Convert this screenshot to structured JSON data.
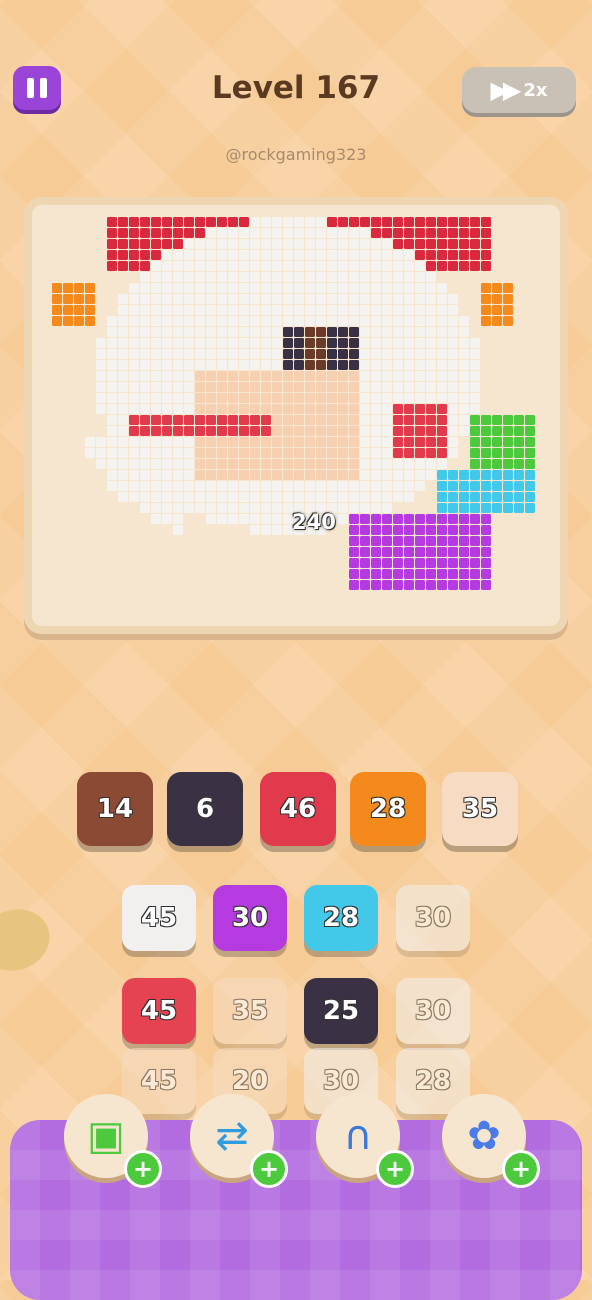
{
  "header": {
    "pause_icon": "pause-icon",
    "level_title": "Level 167",
    "speed_icon": "fast-forward-icon",
    "speed_label": "2x",
    "username": "@rockgaming323"
  },
  "board": {
    "remaining_counter": "240"
  },
  "queue": [
    {
      "value": "14",
      "color": "#8a4a33"
    },
    {
      "value": "6",
      "color": "#3a3244"
    },
    {
      "value": "46",
      "color": "#e13a4c"
    },
    {
      "value": "28",
      "color": "#f58a1c"
    },
    {
      "value": "35",
      "color": "#f7dcc3"
    }
  ],
  "grid": {
    "row1": [
      {
        "value": "45",
        "color": "#f2f0ee"
      },
      {
        "value": "30",
        "color": "#b53be0"
      },
      {
        "value": "28",
        "color": "#42c9ea"
      },
      {
        "value": "30",
        "color": "#f2f0ee"
      }
    ],
    "row2": [
      {
        "value": "45",
        "color": "#e64352"
      },
      {
        "value": "35",
        "color": "#f7dcc3"
      },
      {
        "value": "25",
        "color": "#3a3244"
      },
      {
        "value": "30",
        "color": "#f2f0ee"
      }
    ],
    "row3": [
      {
        "value": "45",
        "color": "#f7dcc3"
      },
      {
        "value": "20",
        "color": "#f7dcc3"
      },
      {
        "value": "30",
        "color": "#f2f0ee"
      },
      {
        "value": "28",
        "color": "#f2f0ee"
      }
    ]
  },
  "powerups": [
    {
      "icon": "add-slot-icon"
    },
    {
      "icon": "swap-icon"
    },
    {
      "icon": "magnet-icon"
    },
    {
      "icon": "flower-icon"
    }
  ],
  "colors": {
    "accent": "#9b45d8",
    "tray": "#b36ce0",
    "plus": "#4cc93d"
  }
}
